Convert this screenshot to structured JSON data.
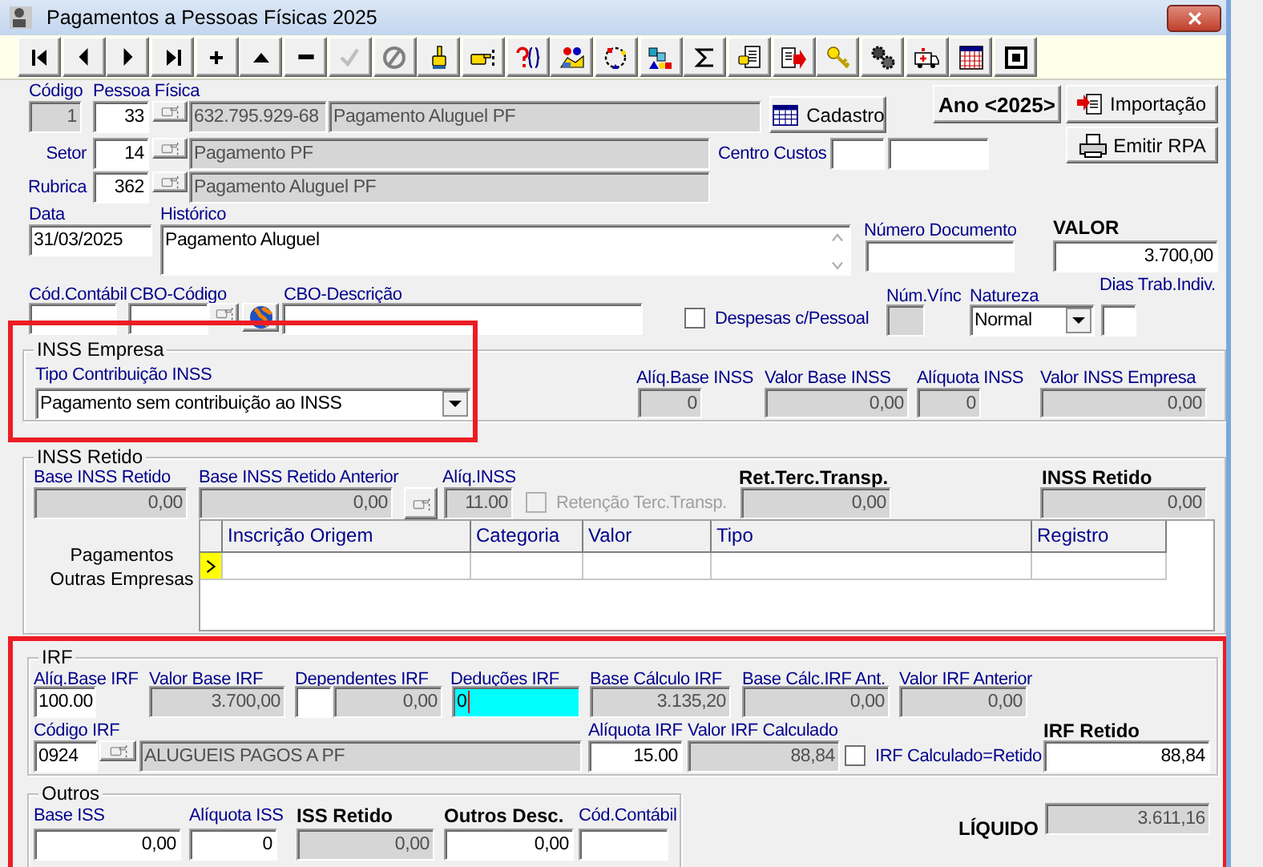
{
  "window": {
    "title": "Pagamentos a Pessoas Físicas 2025"
  },
  "toolbar": [
    {
      "kind": "first",
      "disabled": false
    },
    {
      "kind": "prior",
      "disabled": false
    },
    {
      "kind": "next",
      "disabled": false
    },
    {
      "kind": "last",
      "disabled": false
    },
    {
      "kind": "insert",
      "disabled": false
    },
    {
      "kind": "edit",
      "disabled": false
    },
    {
      "kind": "delete",
      "disabled": false
    },
    {
      "kind": "post",
      "disabled": true
    },
    {
      "kind": "cancel",
      "disabled": false
    },
    {
      "kind": "finger",
      "disabled": false
    },
    {
      "kind": "pointer",
      "disabled": false
    },
    {
      "kind": "query",
      "disabled": false
    },
    {
      "kind": "people",
      "disabled": false
    },
    {
      "kind": "circle",
      "disabled": false
    },
    {
      "kind": "shapes",
      "disabled": false
    },
    {
      "kind": "sum",
      "disabled": false
    },
    {
      "kind": "report",
      "disabled": false
    },
    {
      "kind": "export",
      "disabled": false
    },
    {
      "kind": "key",
      "disabled": false
    },
    {
      "kind": "gears",
      "disabled": false
    },
    {
      "kind": "ambulance",
      "disabled": false
    },
    {
      "kind": "calendar",
      "disabled": false
    },
    {
      "kind": "stop",
      "disabled": false
    }
  ],
  "header": {
    "codigo": {
      "label": "Código",
      "value": "1",
      "readonly": true
    },
    "pessoa_fisica": {
      "label": "Pessoa Física",
      "code": "33",
      "cpf": "632.795.929-68",
      "name": "Pagamento Aluguel PF"
    },
    "setor": {
      "label": "Setor",
      "code": "14",
      "name": "Pagamento PF"
    },
    "rubrica": {
      "label": "Rubrica",
      "code": "362",
      "name": "Pagamento Aluguel PF"
    },
    "centro_custos": {
      "label": "Centro Custos"
    },
    "buttons": {
      "cadastro": "Cadastro",
      "ano": "Ano <2025>",
      "importacao": "Importação",
      "emitir_rpa": "Emitir RPA"
    }
  },
  "lancamento": {
    "data": {
      "label": "Data",
      "value": "31/03/2025",
      "readonly": false
    },
    "historico": {
      "label": "Histórico",
      "value": "Pagamento Aluguel",
      "readonly": false
    },
    "numero_documento": {
      "label": "Número Documento",
      "readonly": false
    },
    "valor": {
      "label": "VALOR",
      "value": "3.700,00",
      "readonly": false
    },
    "cod_contabil": {
      "label": "Cód.Contábil",
      "readonly": false
    },
    "cbo_codigo": {
      "label": "CBO-Código",
      "readonly": false
    },
    "cbo_descricao": {
      "label": "CBO-Descrição",
      "readonly": false
    },
    "despesas_pessoal": {
      "label": "Despesas c/Pessoal",
      "checked": false,
      "disabled": false
    },
    "num_vinc": {
      "label": "Núm.Vínc",
      "readonly": true
    },
    "natureza": {
      "label": "Natureza",
      "value": "Normal"
    },
    "dias_trab": {
      "label": "Dias Trab.Indiv.",
      "readonly": false
    }
  },
  "inss_empresa": {
    "title": "INSS Empresa",
    "tipo_contribuicao": {
      "label": "Tipo Contribuição INSS",
      "value": "Pagamento sem contribuição ao INSS",
      "highlighted": true
    },
    "aliq_base": {
      "label": "Alíq.Base INSS",
      "value": "0",
      "readonly": true
    },
    "valor_base": {
      "label": "Valor Base INSS",
      "value": "0,00",
      "readonly": true
    },
    "aliquota": {
      "label": "Alíquota INSS",
      "value": "0",
      "readonly": true
    },
    "valor_empresa": {
      "label": "Valor INSS Empresa",
      "value": "0,00",
      "readonly": true
    }
  },
  "inss_retido": {
    "title": "INSS Retido",
    "base": {
      "label": "Base INSS Retido",
      "value": "0,00",
      "readonly": true
    },
    "base_anterior": {
      "label": "Base INSS Retido Anterior",
      "value": "0,00",
      "readonly": true
    },
    "aliq": {
      "label": "Alíq.INSS",
      "value": "11.00",
      "readonly": true
    },
    "retencao_terc": {
      "label": "Retenção Terc.Transp.",
      "checked": false,
      "disabled": true
    },
    "ret_terc_transp": {
      "label": "Ret.Terc.Transp.",
      "value": "0,00",
      "readonly": true
    },
    "inss_retido": {
      "label": "INSS Retido",
      "value": "0,00",
      "readonly": true
    },
    "pagamentos_label": "Pagamentos Outras Empresas",
    "grid": {
      "columns": [
        "Inscrição Origem",
        "Categoria",
        "Valor",
        "Tipo",
        "Registro"
      ],
      "rows": [
        {
          "selected": true
        }
      ]
    }
  },
  "irf": {
    "title": "IRF",
    "highlighted": true,
    "aliq_base": {
      "label": "Alíq.Base IRF",
      "value": "100.00",
      "readonly": false
    },
    "valor_base": {
      "label": "Valor Base IRF",
      "value": "3.700,00",
      "readonly": true
    },
    "dependentes": {
      "label": "Dependentes IRF",
      "value": "0,00",
      "readonly": true
    },
    "deducoes": {
      "label": "Deduções IRF",
      "value": "0",
      "readonly": false,
      "focused": true
    },
    "base_calculo": {
      "label": "Base Cálculo IRF",
      "value": "3.135,20",
      "readonly": true
    },
    "base_calc_ant": {
      "label": "Base Cálc.IRF Ant.",
      "value": "0,00",
      "readonly": true
    },
    "valor_anterior": {
      "label": "Valor IRF Anterior",
      "value": "0,00",
      "readonly": true
    },
    "codigo": {
      "label": "Código IRF",
      "value": "0924",
      "readonly": false
    },
    "descricao": {
      "value": "ALUGUEIS PAGOS A PF",
      "readonly": true
    },
    "aliquota": {
      "label": "Alíquota IRF",
      "value": "15.00",
      "readonly": false
    },
    "valor_calculado": {
      "label": "Valor IRF Calculado",
      "value": "88,84",
      "readonly": true
    },
    "calculado_retido": {
      "label": "IRF Calculado=Retido",
      "checked": false,
      "disabled": false
    },
    "irf_retido": {
      "label": "IRF Retido",
      "value": "88,84",
      "readonly": false
    }
  },
  "outros": {
    "title": "Outros",
    "base_iss": {
      "label": "Base ISS",
      "value": "0,00",
      "readonly": false
    },
    "aliquota_iss": {
      "label": "Alíquota ISS",
      "value": "0",
      "readonly": false
    },
    "iss_retido": {
      "label": "ISS Retido",
      "value": "0,00",
      "readonly": true
    },
    "outros_desc": {
      "label": "Outros Desc.",
      "value": "0,00",
      "readonly": false
    },
    "cod_contabil": {
      "label": "Cód.Contábil",
      "readonly": false
    }
  },
  "liquido": {
    "label": "LÍQUIDO",
    "value": "3.611,16",
    "readonly": true
  }
}
